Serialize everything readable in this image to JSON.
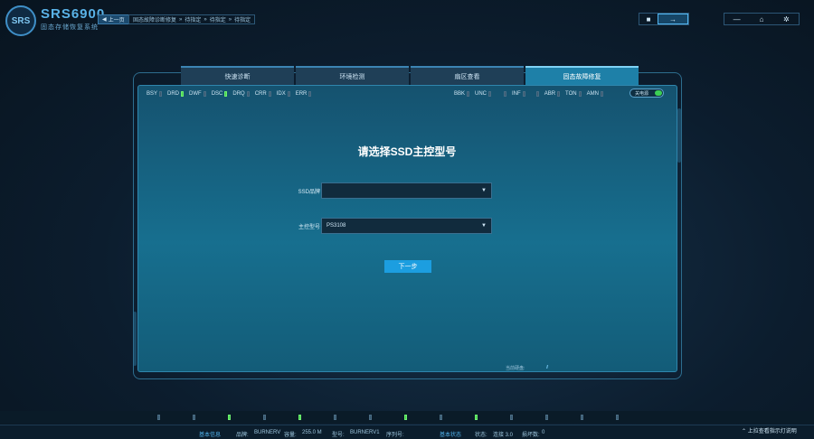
{
  "header": {
    "logo_text": "SRS",
    "title": "SRS6900",
    "subtitle": "固态存储恢复系统",
    "back_label": "上一页",
    "breadcrumbs": [
      "固态故障诊断修复",
      "待指定",
      "待指定",
      "待指定"
    ]
  },
  "tabs": [
    {
      "label": "快速诊断",
      "active": false
    },
    {
      "label": "环境检测",
      "active": false
    },
    {
      "label": "扇区查看",
      "active": false
    },
    {
      "label": "固态故障修复",
      "active": true
    }
  ],
  "status_left": [
    {
      "label": "BSY",
      "on": false
    },
    {
      "label": "DRD",
      "on": true
    },
    {
      "label": "DWF",
      "on": false
    },
    {
      "label": "DSC",
      "on": true
    },
    {
      "label": "DRQ",
      "on": false
    },
    {
      "label": "CRR",
      "on": false
    },
    {
      "label": "IDX",
      "on": false
    },
    {
      "label": "ERR",
      "on": false
    }
  ],
  "status_right": [
    {
      "label": "BBK",
      "on": false
    },
    {
      "label": "UNC",
      "on": false
    },
    {
      "label": "INF",
      "on": false
    },
    {
      "label": "ABR",
      "on": false
    },
    {
      "label": "TON",
      "on": false
    },
    {
      "label": "AMN",
      "on": false
    }
  ],
  "power_toggle": {
    "label": "关电源",
    "on": true
  },
  "form": {
    "title": "请选择SSD主控型号",
    "brand_label": "SSD品牌",
    "brand_value": "",
    "controller_label": "主控型号",
    "controller_value": "PS3108",
    "next_label": "下一步"
  },
  "panel_footer": {
    "label": "当前硬盘:"
  },
  "bottom_leds": [
    false,
    false,
    true,
    false,
    true,
    false,
    false,
    true,
    false,
    true,
    false,
    false,
    false,
    false
  ],
  "footer": {
    "basic_info_label": "基本信息",
    "brand_text": "品牌:",
    "brand_value": "BURNERV",
    "capacity_text": "容量:",
    "capacity_value": "255.0 M",
    "model_text": "型号:",
    "model_value": "BURNERV1",
    "serial_text": "序列号:",
    "basic_status_label": "基本状态",
    "state_text": "状态:",
    "state_value": "连接 3.0",
    "bad_text": "损坏数:",
    "bad_value": "0",
    "help_text": "上拉查看指示灯说明"
  },
  "colors": {
    "accent": "#1c9ee0",
    "led_on": "#45d04b",
    "panel": "#176f8f"
  }
}
